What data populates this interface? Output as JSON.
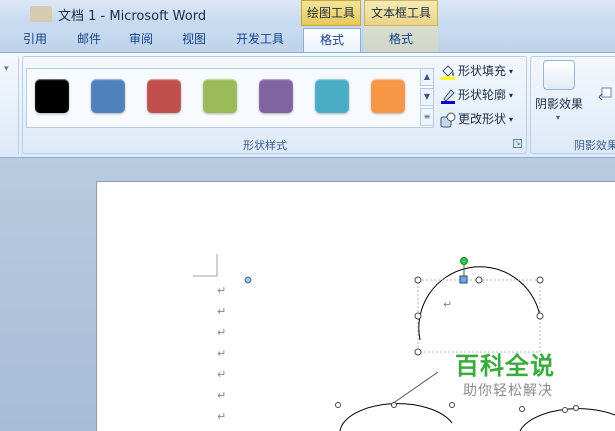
{
  "window": {
    "title": "文档 1 - Microsoft Word",
    "context_groups": [
      "绘图工具",
      "文本框工具"
    ]
  },
  "tabs": [
    {
      "label": "引用"
    },
    {
      "label": "邮件"
    },
    {
      "label": "审阅"
    },
    {
      "label": "视图"
    },
    {
      "label": "开发工具"
    },
    {
      "label": "格式",
      "active": true
    },
    {
      "label": "格式"
    }
  ],
  "ribbon": {
    "shape_styles": {
      "label": "形状样式",
      "swatches": [
        "#000000",
        "#4f81bd",
        "#c0504d",
        "#9bbb59",
        "#8064a2",
        "#4bacc6",
        "#f79646"
      ],
      "commands": [
        {
          "label": "形状填充",
          "icon": "paint-bucket-icon"
        },
        {
          "label": "形状轮廓",
          "icon": "pencil-outline-icon"
        },
        {
          "label": "更改形状",
          "icon": "change-shape-icon"
        }
      ]
    },
    "shadow": {
      "button_label": "阴影效果",
      "group_label": "阴影效果"
    }
  },
  "document": {
    "paragraph_mark": "↵"
  },
  "watermark": {
    "title": "百科全说",
    "subtitle": "助你轻松解决"
  }
}
